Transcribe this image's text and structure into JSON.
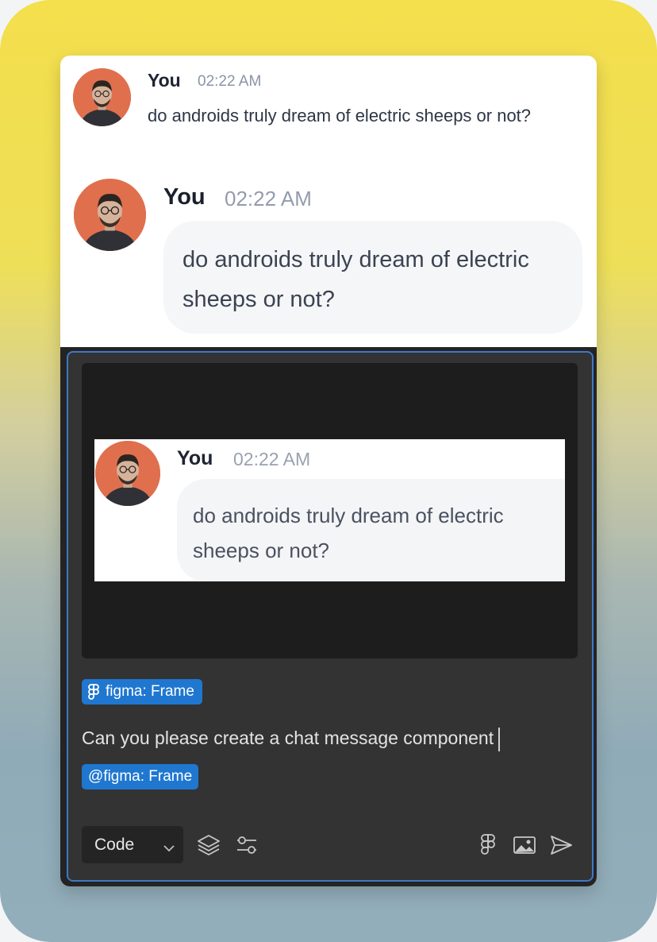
{
  "messages": [
    {
      "author": "You",
      "time": "02:22 AM",
      "text": "do androids truly dream of electric sheeps or not?"
    },
    {
      "author": "You",
      "time": "02:22 AM",
      "text": "do androids truly dream of electric sheeps or not?"
    }
  ],
  "composer": {
    "preview": {
      "author": "You",
      "time": "02:22 AM",
      "text": "do androids truly dream of electric sheeps or not?"
    },
    "attachment_chip": "figma: Frame",
    "prompt_text": "Can you please create a chat message component",
    "mention": "@figma: Frame",
    "mode_select": "Code",
    "toolbar_icons": [
      "layers-icon",
      "sliders-icon",
      "figma-icon",
      "image-icon",
      "send-icon"
    ]
  },
  "colors": {
    "accent": "#1f77d0",
    "avatar_bg": "#e06f4e",
    "panel_bg": "#333333",
    "focus_border": "#3f78c7"
  }
}
